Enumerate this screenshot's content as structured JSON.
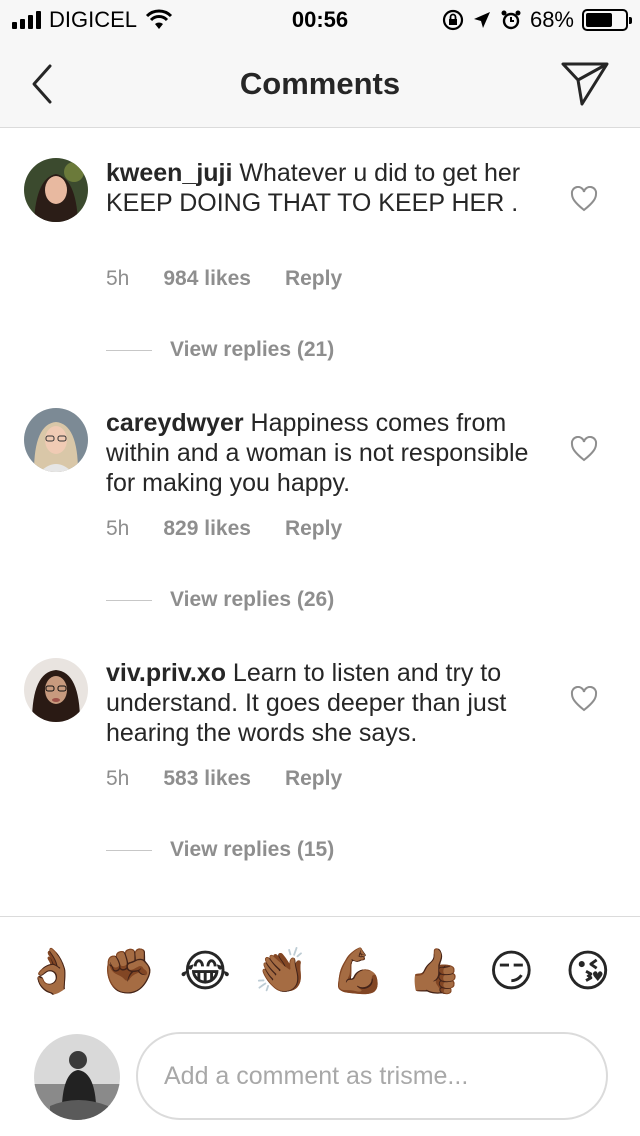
{
  "status_bar": {
    "carrier": "DIGICEL",
    "time": "00:56",
    "battery_percent": "68%",
    "battery_level": 0.68
  },
  "nav": {
    "title": "Comments",
    "back_icon": "chevron-left-icon",
    "send_icon": "paper-plane-icon"
  },
  "comments": [
    {
      "username": "kween_juji",
      "text": " Whatever u did to get her KEEP DOING THAT TO KEEP HER .",
      "time": "5h",
      "likes": "984 likes",
      "reply": "Reply",
      "view_replies": "View replies (21)"
    },
    {
      "username": "careydwyer",
      "text": " Happiness comes from within and a woman is not responsible for making you happy.",
      "time": "5h",
      "likes": "829 likes",
      "reply": "Reply",
      "view_replies": "View replies (26)"
    },
    {
      "username": "viv.priv.xo",
      "text": " Learn to listen and try to understand. It goes deeper than just hearing the words she says.",
      "time": "5h",
      "likes": "583 likes",
      "reply": "Reply",
      "view_replies": "View replies (15)"
    }
  ],
  "emojis": [
    "👌🏾",
    "✊🏾",
    "😂",
    "👏🏾",
    "💪🏾",
    "👍🏾",
    "😏",
    "😘"
  ],
  "comment_input": {
    "placeholder": "Add a comment as trisme..."
  }
}
